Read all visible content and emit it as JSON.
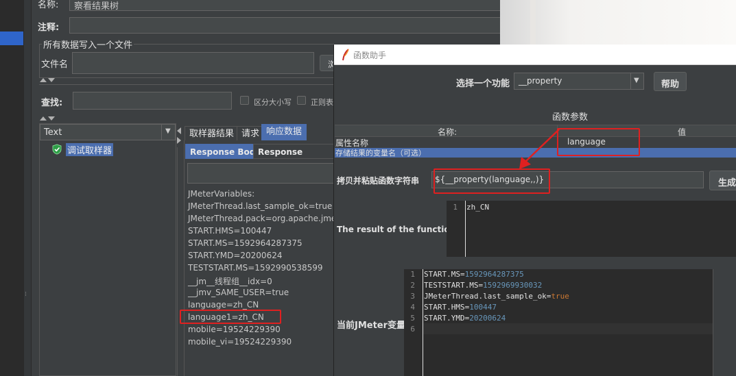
{
  "top": {
    "name_label": "名称:",
    "name_value": "察看结果树",
    "comment_label": "注释:"
  },
  "file_section": {
    "title": "所有数据写入一个文件",
    "filename_label": "文件名",
    "browse_label": "浏"
  },
  "search": {
    "label": "查找:",
    "case_label": "区分大小写",
    "regex_label": "正则表"
  },
  "tree": {
    "renderer": "Text",
    "items": [
      "调试取样器"
    ]
  },
  "result_tabs": [
    "取样器结果",
    "请求",
    "响应数据"
  ],
  "response_tabs": [
    "Response Body",
    "Response headers"
  ],
  "response_lines": [
    "JMeterVariables:",
    "JMeterThread.last_sample_ok=true",
    "JMeterThread.pack=org.apache.jmeter",
    "START.HMS=100447",
    "START.MS=1592964287375",
    "START.YMD=20200624",
    "TESTSTART.MS=1592990538599",
    "__jm__线程组__idx=0",
    "__jmv_SAME_USER=true",
    "language=zh_CN",
    "language1=zh_CN",
    "mobile=19524229390",
    "mobile_vi=19524229390"
  ],
  "dialog": {
    "title": "函数助手",
    "select_label": "选择一个功能",
    "function_value": "__property",
    "help_label": "帮助",
    "params_title": "函数参数",
    "table_headers": [
      "名称:",
      "值"
    ],
    "rows": [
      {
        "name": "属性名称",
        "value": "language"
      },
      {
        "name": "存储结果的变量名（可选）",
        "value": ""
      }
    ],
    "copy_label": "拷贝并粘贴函数字符串",
    "function_string": "${__property(language,,)}",
    "generate_label": "生成",
    "result_label": "The result of the function is",
    "result_lines": [
      {
        "num": "1",
        "text": "zh_CN"
      }
    ],
    "vars_label": "当前JMeter变量",
    "var_lines": [
      {
        "num": "1",
        "key": "START.MS=",
        "val": "1592964287375"
      },
      {
        "num": "2",
        "key": "TESTSTART.MS=",
        "val": "1592969930032"
      },
      {
        "num": "3",
        "key": "JMeterThread.last_sample_ok=",
        "val": "true"
      },
      {
        "num": "4",
        "key": "START.HMS=",
        "val": "100447"
      },
      {
        "num": "5",
        "key": "START.YMD=",
        "val": "20200624"
      },
      {
        "num": "6",
        "key": "",
        "val": ""
      }
    ]
  },
  "colors": {
    "panel": "#3c3f41",
    "selection": "#4b6eaf",
    "highlight_box": "#e02020",
    "number": "#6897bb",
    "keyword": "#cc7832"
  }
}
